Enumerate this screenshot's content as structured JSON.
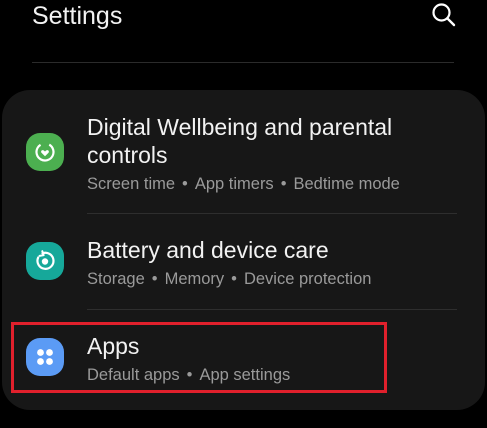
{
  "header": {
    "title": "Settings"
  },
  "colors": {
    "background": "#000000",
    "card": "#171717",
    "wellbeing_icon": "#4caf50",
    "battery_icon": "#16a89a",
    "apps_icon": "#5b9bf5",
    "highlight": "#e0202c"
  },
  "items": [
    {
      "icon": "digital-wellbeing-icon",
      "title_line1": "Digital Wellbeing and parental",
      "title_line2": "controls",
      "subtitle": [
        "Screen time",
        "App timers",
        "Bedtime mode"
      ]
    },
    {
      "icon": "device-care-icon",
      "title_line1": "Battery and device care",
      "subtitle": [
        "Storage",
        "Memory",
        "Device protection"
      ]
    },
    {
      "icon": "apps-grid-icon",
      "title_line1": "Apps",
      "subtitle": [
        "Default apps",
        "App settings"
      ]
    }
  ],
  "separator": "•"
}
